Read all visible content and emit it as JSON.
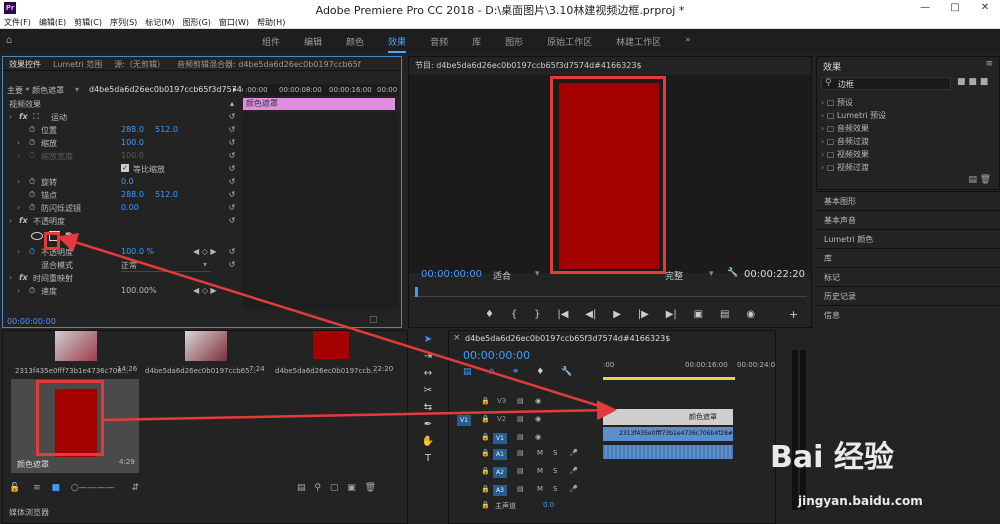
{
  "window": {
    "title": "Adobe Premiere Pro CC 2018 - D:\\桌面图片\\3.10林建视频边框.prproj *",
    "app_icon": "Pr"
  },
  "menu": [
    "文件(F)",
    "编辑(E)",
    "剪辑(C)",
    "序列(S)",
    "标记(M)",
    "图形(G)",
    "窗口(W)",
    "帮助(H)"
  ],
  "workspaces": [
    "组件",
    "编辑",
    "颜色",
    "效果",
    "音频",
    "库",
    "图形",
    "原始工作区",
    "林建工作区"
  ],
  "active_workspace": "效果",
  "effect_controls": {
    "tabs": [
      "效果控件",
      "Lumetri 范围",
      "源:（无剪辑）",
      "音频剪辑混合器: d4be5da6d26ec0b0197ccb65f"
    ],
    "master": "主要 * 颜色遮罩",
    "clip": "d4be5da6d26ec0b0197ccb65f3d7574d#...",
    "timeline_start": ":00:00",
    "timeline_marks": [
      "00:00:08:00",
      "00:00:16:00",
      "00:00"
    ],
    "clip_bar_label": "颜色遮罩",
    "section_video": "视频效果",
    "motion": "运动",
    "position_label": "位置",
    "position_x": "288.0",
    "position_y": "512.0",
    "scale_label": "缩放",
    "scale": "100.0",
    "scale_width_label": "缩放宽度",
    "scale_width": "100.0",
    "uniform_scale": "等比缩放",
    "rotation_label": "旋转",
    "rotation": "0.0",
    "anchor_label": "锚点",
    "anchor_x": "288.0",
    "anchor_y": "512.0",
    "flicker_label": "防闪烁滤镜",
    "flicker": "0.00",
    "opacity_group": "不透明度",
    "opacity_label": "不透明度",
    "opacity": "100.0 %",
    "blend_label": "混合模式",
    "blend": "正常",
    "time_remap": "时间重映射",
    "speed_label": "速度",
    "speed": "100.00%",
    "timecode": "00:00:00:00"
  },
  "program_monitor": {
    "title": "节目: d4be5da6d26ec0b0197ccb65f3d7574d#4166323$",
    "timecode_in": "00:00:00:00",
    "fit": "适合",
    "quality": "完整",
    "duration": "00:00:22:20"
  },
  "project_bin": {
    "items": [
      {
        "name": "2313f435e0fff73b1e4736c706...",
        "duration": "14:26"
      },
      {
        "name": "d4be5da6d26ec0b0197ccb65...",
        "duration": "7:24"
      },
      {
        "name": "d4be5da6d26ec0b0197ccb...",
        "duration": "22:20"
      }
    ],
    "selected": {
      "name": "颜色遮罩",
      "duration": "4:29"
    },
    "footer": "媒体浏览器"
  },
  "timeline": {
    "title": "d4be5da6d26ec0b0197ccb65f3d7574d#4166323$",
    "timecode": "00:00:00:00",
    "ruler": [
      ":00:00",
      "00:00:16:00",
      "00:00:24:0"
    ],
    "ruler_left": ":00",
    "tracks_video": [
      "V3",
      "V2",
      "V1"
    ],
    "tracks_audio": [
      "A1",
      "A2",
      "A3"
    ],
    "master": "主声道",
    "master_val": "0.0",
    "clip_v2": "颜色遮罩",
    "clip_v1": "2313f435e0fff73b1e4736c706b4f28#6052130"
  },
  "effects_panel": {
    "title": "效果",
    "search": "边框",
    "items": [
      "预设",
      "Lumetri 预设",
      "音频效果",
      "音频过渡",
      "视频效果",
      "视频过渡"
    ],
    "sections": [
      "基本图形",
      "基本声音",
      "Lumetri 颜色",
      "库",
      "标记",
      "历史记录",
      "信息"
    ]
  },
  "watermark": {
    "logo": "Bai 经验",
    "url": "jingyan.baidu.com"
  },
  "colors": {
    "accent": "#3d9bff",
    "mask_red": "#a30000",
    "annotation": "#e33b3b",
    "clip_pink": "#e08ee0"
  }
}
